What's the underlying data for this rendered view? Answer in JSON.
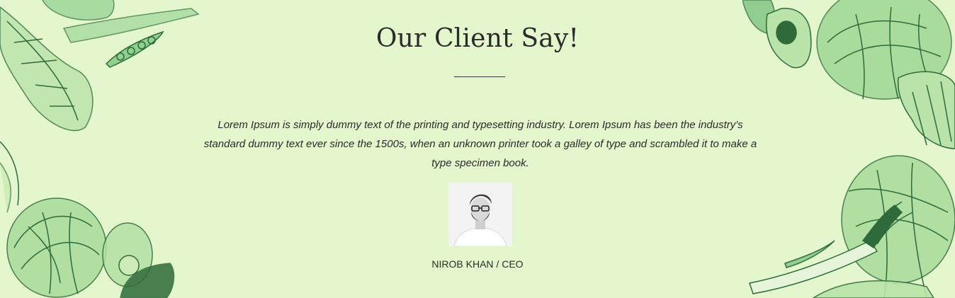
{
  "testimonial": {
    "heading": "Our Client Say!",
    "quote": "Lorem Ipsum is simply dummy text of the printing and typesetting industry. Lorem Ipsum has been the industry's standard dummy text ever since the 1500s, when an unknown printer took a galley of type and scrambled it to make a type specimen book.",
    "client_name": "NIROB KHAN / CEO",
    "avatar_icon": "person-photo"
  },
  "colors": {
    "background": "#e3f6cc",
    "vegetable_light": "#7cc47f",
    "vegetable_dark": "#2f6b3a"
  }
}
